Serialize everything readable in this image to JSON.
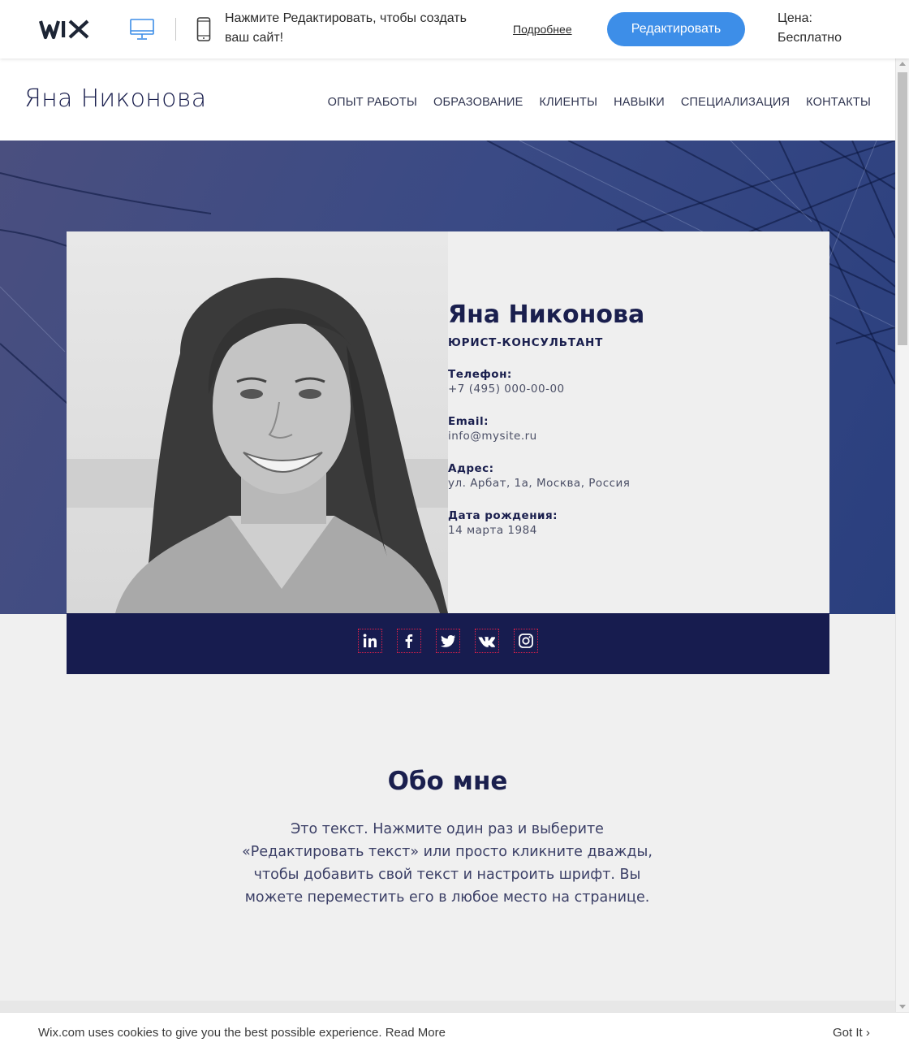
{
  "wix_bar": {
    "logo": "WiX",
    "message": "Нажмите Редактировать, чтобы создать ваш сайт!",
    "more_link": "Подробнее",
    "edit_button": "Редактировать",
    "price_label": "Цена:",
    "price_value": "Бесплатно",
    "desktop_icon": "desktop-icon",
    "mobile_icon": "mobile-icon",
    "accent_color": "#3d8ee8"
  },
  "site": {
    "title": "Яна Никонова",
    "nav": [
      "ОПЫТ РАБОТЫ",
      "ОБРАЗОВАНИЕ",
      "КЛИЕНТЫ",
      "НАВЫКИ",
      "СПЕЦИАЛИЗАЦИЯ",
      "КОНТАКТЫ"
    ]
  },
  "profile": {
    "name": "Яна Никонова",
    "role": "ЮРИСТ-КОНСУЛЬТАНТ",
    "items": [
      {
        "label": "Телефон:",
        "value": "+7 (495) 000-00-00"
      },
      {
        "label": "Email:",
        "value": "info@mysite.ru"
      },
      {
        "label": "Адрес:",
        "value": "ул. Арбат, 1а, Москва, Россия"
      },
      {
        "label": "Дата рождения:",
        "value": "14 марта 1984"
      }
    ],
    "photo": "portrait-photo"
  },
  "social": {
    "icons": [
      "linkedin-icon",
      "facebook-icon",
      "twitter-icon",
      "vk-icon",
      "instagram-icon"
    ],
    "bar_color": "#171c4f"
  },
  "about": {
    "title": "Обо мне",
    "text": "Это текст. Нажмите один раз и выберите «Редактировать текст» или просто кликните дважды, чтобы добавить свой текст и настроить шрифт. Вы можете переместить его в любое место на странице."
  },
  "cookie": {
    "text": "Wix.com uses cookies to give you the best possible experience.",
    "read_more": "Read More",
    "button": "Got It"
  },
  "colors": {
    "primary": "#1a1f4e",
    "hero": "#3a4a85"
  }
}
